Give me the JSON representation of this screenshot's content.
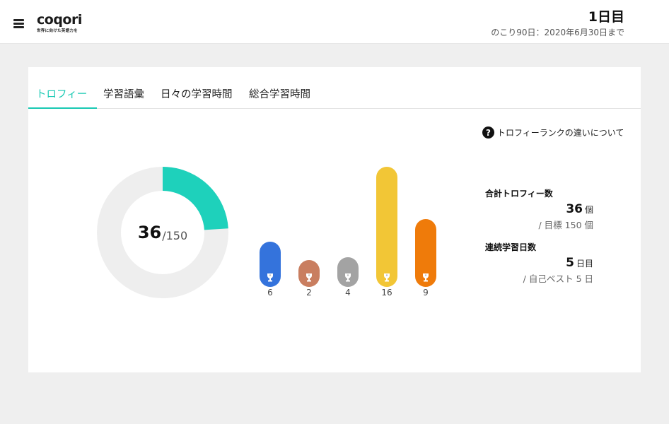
{
  "header": {
    "logo_text": "coqori",
    "logo_tagline": "世界に向けた英語力を",
    "day_count": "1日目",
    "remaining": "のこり90日：2020年6月30日まで"
  },
  "tabs": [
    {
      "label": "トロフィー",
      "active": true
    },
    {
      "label": "学習語彙",
      "active": false
    },
    {
      "label": "日々の学習時間",
      "active": false
    },
    {
      "label": "総合学習時間",
      "active": false
    }
  ],
  "help_link": "トロフィーランクの違いについて",
  "donut": {
    "value": "36",
    "max": "/150",
    "fraction": 0.24,
    "fill_color": "#1ed1bb",
    "track_color": "#eeeeee"
  },
  "chart_data": {
    "type": "bar",
    "categories": [
      "",
      "",
      "",
      "",
      ""
    ],
    "values": [
      6,
      2,
      4,
      16,
      9
    ],
    "colors": [
      "#3473dc",
      "#c97e60",
      "#a3a3a3",
      "#f2c636",
      "#ef7b0a"
    ],
    "icons": [
      "trophy-icon",
      "trophy-icon",
      "trophy-icon",
      "trophy-icon",
      "trophy-icon"
    ],
    "labels": [
      "6",
      "2",
      "4",
      "16",
      "9"
    ]
  },
  "stats": {
    "total": {
      "title": "合計トロフィー数",
      "value": "36",
      "unit": "個",
      "sub": "/ 目標 150 個"
    },
    "streak": {
      "title": "連続学習日数",
      "value": "5",
      "unit": "日目",
      "sub": "/ 自己ベスト 5 日"
    }
  }
}
